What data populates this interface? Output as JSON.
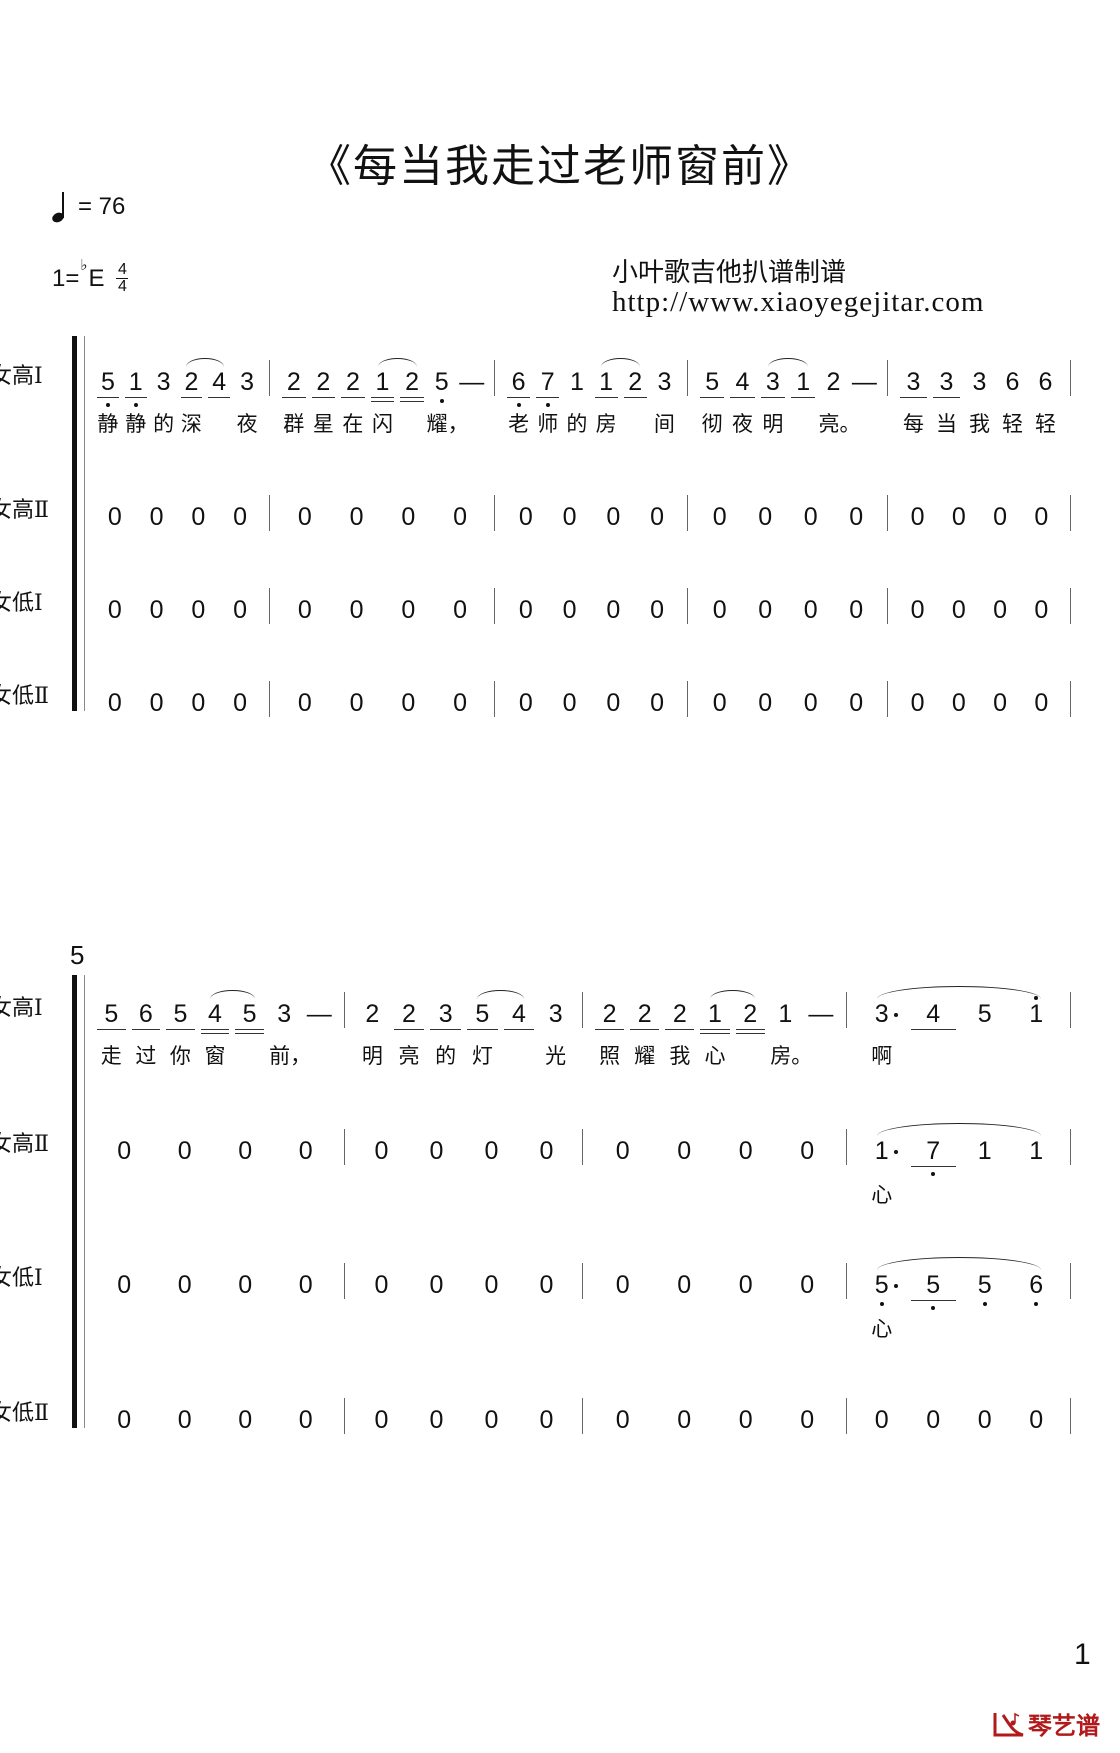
{
  "title": "《每当我走过老师窗前》",
  "tempo": {
    "icon": "quarter-note-icon",
    "text": "= 76"
  },
  "key": {
    "prefix": "1=",
    "flat": "♭",
    "note": "E",
    "time_top": "4",
    "time_bottom": "4"
  },
  "credit": {
    "author": "小叶歌吉他扒谱制谱",
    "url": "http://www.xiaoyegejitar.com"
  },
  "page_number": "1",
  "logo": {
    "icon": "piano-music-logo-icon",
    "text": "琴艺谱",
    "color": "#b11a1a"
  },
  "voices": [
    "女高Ⅰ",
    "女高Ⅱ",
    "女低Ⅰ",
    "女低Ⅱ"
  ],
  "systems": [
    {
      "measure_number": "",
      "parts": [
        [
          [
            {
              "n": "5",
              "u": 1,
              "db": 1,
              "l": "静"
            },
            {
              "n": "1",
              "u": 1,
              "db": 1,
              "l": "静"
            },
            {
              "n": "3",
              "l": "的"
            },
            {
              "n": "2",
              "u": 1,
              "s": "start",
              "l": "深"
            },
            {
              "n": "4",
              "u": 1,
              "s": "end"
            },
            {
              "n": "3",
              "l": "夜"
            }
          ],
          [
            {
              "n": "2",
              "u": 1,
              "l": "群"
            },
            {
              "n": "2",
              "u": 1,
              "l": "星"
            },
            {
              "n": "2",
              "u": 1,
              "l": "在"
            },
            {
              "n": "1",
              "u": 2,
              "s": "start",
              "l": "闪"
            },
            {
              "n": "2",
              "u": 2,
              "s": "end"
            },
            {
              "n": "5",
              "db": 1,
              "l": "耀，"
            },
            {
              "n": "—"
            }
          ],
          [
            {
              "n": "6",
              "u": 1,
              "db": 1,
              "l": "老"
            },
            {
              "n": "7",
              "u": 1,
              "db": 1,
              "l": "师"
            },
            {
              "n": "1",
              "l": "的"
            },
            {
              "n": "1",
              "u": 1,
              "s": "start",
              "l": "房"
            },
            {
              "n": "2",
              "u": 1,
              "s": "end"
            },
            {
              "n": "3",
              "l": "间"
            }
          ],
          [
            {
              "n": "5",
              "u": 1,
              "l": "彻"
            },
            {
              "n": "4",
              "u": 1,
              "l": "夜"
            },
            {
              "n": "3",
              "u": 1,
              "s": "start",
              "l": "明"
            },
            {
              "n": "1",
              "u": 1,
              "s": "end"
            },
            {
              "n": "2",
              "l": "亮。"
            },
            {
              "n": "—"
            }
          ],
          [
            {
              "n": "3",
              "u": 1,
              "l": "每"
            },
            {
              "n": "3",
              "u": 1,
              "l": "当"
            },
            {
              "n": "3",
              "l": "我"
            },
            {
              "n": "6",
              "l": "轻"
            },
            {
              "n": "6",
              "l": "轻"
            }
          ]
        ],
        [
          [
            {
              "n": "0"
            },
            {
              "n": "0"
            },
            {
              "n": "0"
            },
            {
              "n": "0"
            }
          ],
          [
            {
              "n": "0"
            },
            {
              "n": "0"
            },
            {
              "n": "0"
            },
            {
              "n": "0"
            }
          ],
          [
            {
              "n": "0"
            },
            {
              "n": "0"
            },
            {
              "n": "0"
            },
            {
              "n": "0"
            }
          ],
          [
            {
              "n": "0"
            },
            {
              "n": "0"
            },
            {
              "n": "0"
            },
            {
              "n": "0"
            }
          ],
          [
            {
              "n": "0"
            },
            {
              "n": "0"
            },
            {
              "n": "0"
            },
            {
              "n": "0"
            }
          ]
        ],
        [
          [
            {
              "n": "0"
            },
            {
              "n": "0"
            },
            {
              "n": "0"
            },
            {
              "n": "0"
            }
          ],
          [
            {
              "n": "0"
            },
            {
              "n": "0"
            },
            {
              "n": "0"
            },
            {
              "n": "0"
            }
          ],
          [
            {
              "n": "0"
            },
            {
              "n": "0"
            },
            {
              "n": "0"
            },
            {
              "n": "0"
            }
          ],
          [
            {
              "n": "0"
            },
            {
              "n": "0"
            },
            {
              "n": "0"
            },
            {
              "n": "0"
            }
          ],
          [
            {
              "n": "0"
            },
            {
              "n": "0"
            },
            {
              "n": "0"
            },
            {
              "n": "0"
            }
          ]
        ],
        [
          [
            {
              "n": "0"
            },
            {
              "n": "0"
            },
            {
              "n": "0"
            },
            {
              "n": "0"
            }
          ],
          [
            {
              "n": "0"
            },
            {
              "n": "0"
            },
            {
              "n": "0"
            },
            {
              "n": "0"
            }
          ],
          [
            {
              "n": "0"
            },
            {
              "n": "0"
            },
            {
              "n": "0"
            },
            {
              "n": "0"
            }
          ],
          [
            {
              "n": "0"
            },
            {
              "n": "0"
            },
            {
              "n": "0"
            },
            {
              "n": "0"
            }
          ],
          [
            {
              "n": "0"
            },
            {
              "n": "0"
            },
            {
              "n": "0"
            },
            {
              "n": "0"
            }
          ]
        ]
      ]
    },
    {
      "measure_number": "5",
      "parts": [
        [
          [
            {
              "n": "5",
              "u": 1,
              "l": "走"
            },
            {
              "n": "6",
              "u": 1,
              "l": "过"
            },
            {
              "n": "5",
              "u": 1,
              "l": "你"
            },
            {
              "n": "4",
              "u": 2,
              "s": "start",
              "l": "窗"
            },
            {
              "n": "5",
              "u": 2,
              "s": "end"
            },
            {
              "n": "3",
              "l": "前，"
            },
            {
              "n": "—"
            }
          ],
          [
            {
              "n": "2",
              "l": "明"
            },
            {
              "n": "2",
              "u": 1,
              "l": "亮"
            },
            {
              "n": "3",
              "u": 1,
              "l": "的"
            },
            {
              "n": "5",
              "u": 1,
              "s": "start",
              "l": "灯"
            },
            {
              "n": "4",
              "u": 1,
              "s": "end"
            },
            {
              "n": "3",
              "l": "光"
            }
          ],
          [
            {
              "n": "2",
              "u": 1,
              "l": "照"
            },
            {
              "n": "2",
              "u": 1,
              "l": "耀"
            },
            {
              "n": "2",
              "u": 1,
              "l": "我"
            },
            {
              "n": "1",
              "u": 2,
              "s": "start",
              "l": "心"
            },
            {
              "n": "2",
              "u": 2,
              "s": "end"
            },
            {
              "n": "1",
              "l": "房。"
            },
            {
              "n": "—"
            }
          ],
          [
            {
              "n": "3",
              "aug": 1,
              "s": "start",
              "l": "啊"
            },
            {
              "n": "4",
              "u": 1
            },
            {
              "n": "5"
            },
            {
              "n": "1",
              "da": 1,
              "s": "end"
            }
          ]
        ],
        [
          [
            {
              "n": "0"
            },
            {
              "n": "0"
            },
            {
              "n": "0"
            },
            {
              "n": "0"
            }
          ],
          [
            {
              "n": "0"
            },
            {
              "n": "0"
            },
            {
              "n": "0"
            },
            {
              "n": "0"
            }
          ],
          [
            {
              "n": "0"
            },
            {
              "n": "0"
            },
            {
              "n": "0"
            },
            {
              "n": "0"
            }
          ],
          [
            {
              "n": "1",
              "aug": 1,
              "s": "start",
              "l": "心"
            },
            {
              "n": "7",
              "u": 1,
              "db": 1
            },
            {
              "n": "1"
            },
            {
              "n": "1",
              "s": "end"
            }
          ]
        ],
        [
          [
            {
              "n": "0"
            },
            {
              "n": "0"
            },
            {
              "n": "0"
            },
            {
              "n": "0"
            }
          ],
          [
            {
              "n": "0"
            },
            {
              "n": "0"
            },
            {
              "n": "0"
            },
            {
              "n": "0"
            }
          ],
          [
            {
              "n": "0"
            },
            {
              "n": "0"
            },
            {
              "n": "0"
            },
            {
              "n": "0"
            }
          ],
          [
            {
              "n": "5",
              "aug": 1,
              "db": 1,
              "s": "start",
              "l": "心"
            },
            {
              "n": "5",
              "u": 1,
              "db": 1
            },
            {
              "n": "5",
              "db": 1
            },
            {
              "n": "6",
              "db": 1,
              "s": "end"
            }
          ]
        ],
        [
          [
            {
              "n": "0"
            },
            {
              "n": "0"
            },
            {
              "n": "0"
            },
            {
              "n": "0"
            }
          ],
          [
            {
              "n": "0"
            },
            {
              "n": "0"
            },
            {
              "n": "0"
            },
            {
              "n": "0"
            }
          ],
          [
            {
              "n": "0"
            },
            {
              "n": "0"
            },
            {
              "n": "0"
            },
            {
              "n": "0"
            }
          ],
          [
            {
              "n": "0"
            },
            {
              "n": "0"
            },
            {
              "n": "0"
            },
            {
              "n": "0"
            }
          ]
        ]
      ]
    }
  ]
}
